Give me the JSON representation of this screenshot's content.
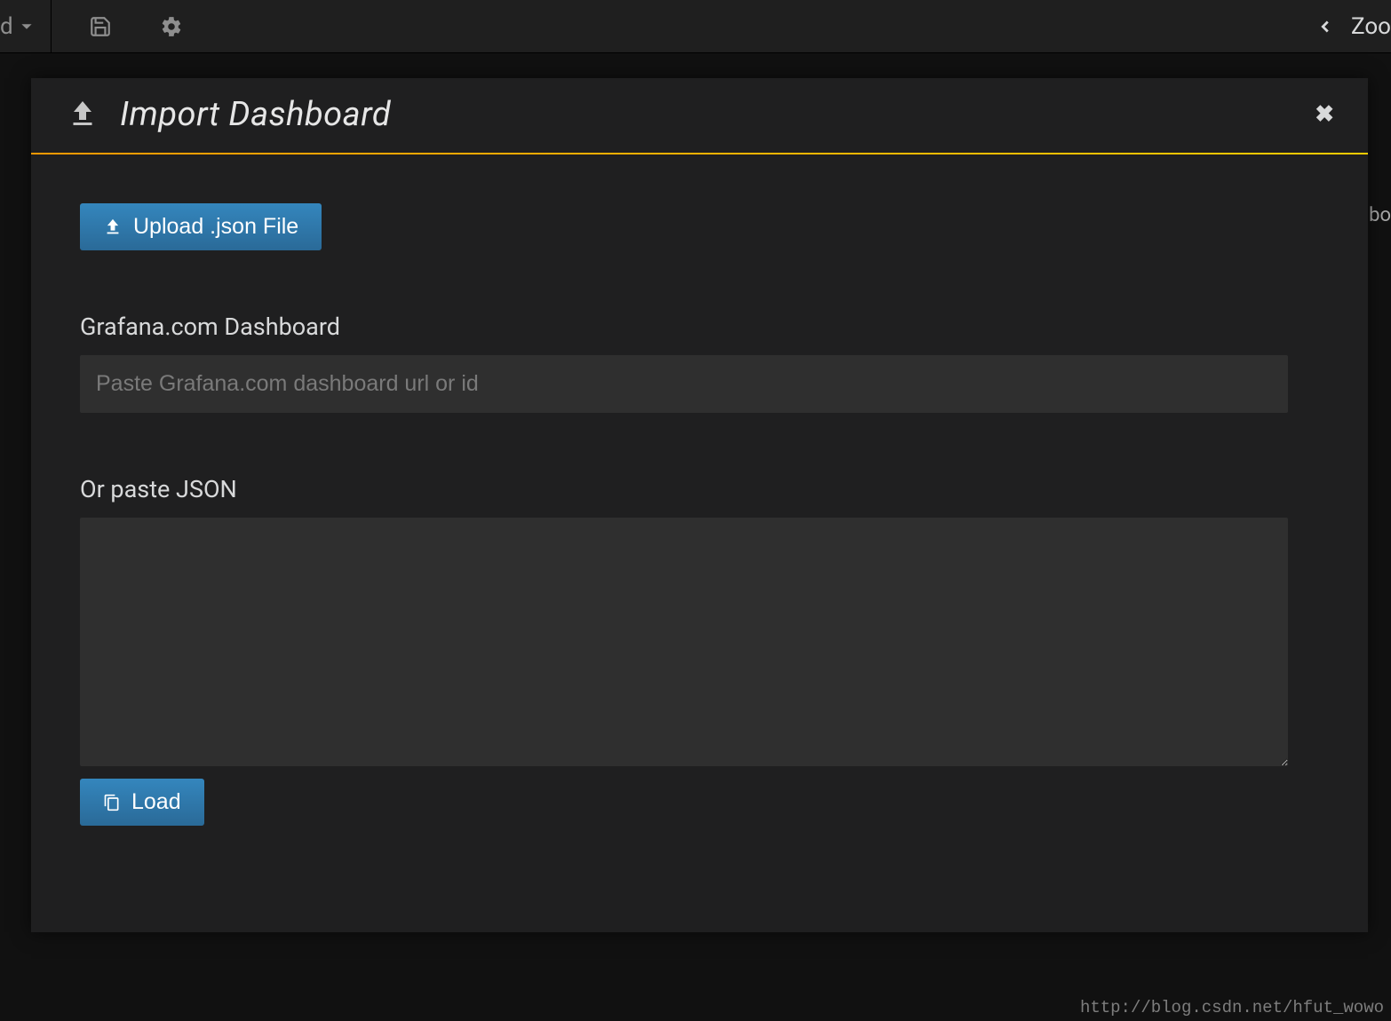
{
  "toolbar": {
    "dashboard_text_fragment": "d",
    "zoom_text_fragment": "Zoo"
  },
  "backdrop": {
    "right_fragment": "nbo"
  },
  "modal": {
    "title": "Import Dashboard",
    "upload_button_label": "Upload .json File",
    "grafana_section_label": "Grafana.com Dashboard",
    "grafana_input_placeholder": "Paste Grafana.com dashboard url or id",
    "json_section_label": "Or paste JSON",
    "load_button_label": "Load"
  },
  "watermark": "http://blog.csdn.net/hfut_wowo"
}
